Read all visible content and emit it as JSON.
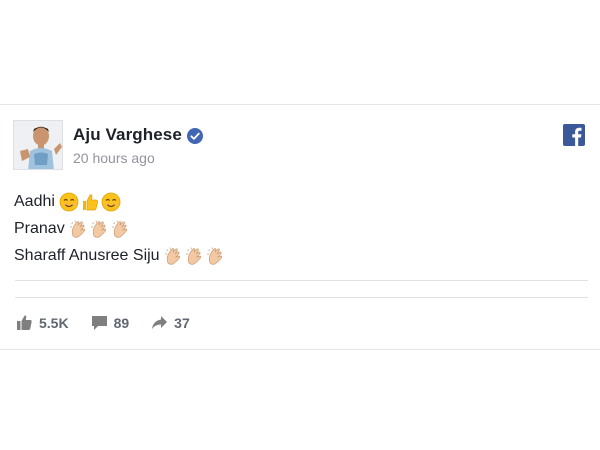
{
  "post": {
    "author": "Aju Varghese",
    "verified": true,
    "timestamp": "20 hours ago",
    "lines": [
      {
        "text": "Aadhi",
        "emojis": [
          "smiling-face",
          "thumbs-up",
          "smiling-face"
        ]
      },
      {
        "text": "Pranav",
        "emojis": [
          "clapping-hands",
          "clapping-hands",
          "clapping-hands"
        ]
      },
      {
        "text": "Sharaff Anusree Siju",
        "emojis": [
          "clapping-hands",
          "clapping-hands",
          "clapping-hands"
        ]
      }
    ]
  },
  "stats": {
    "likes": "5.5K",
    "comments": "89",
    "shares": "37"
  },
  "colors": {
    "facebook_blue": "#3b5998",
    "verified_blue": "#4267b2",
    "muted_text": "#90949c",
    "stat_text": "#616770"
  }
}
